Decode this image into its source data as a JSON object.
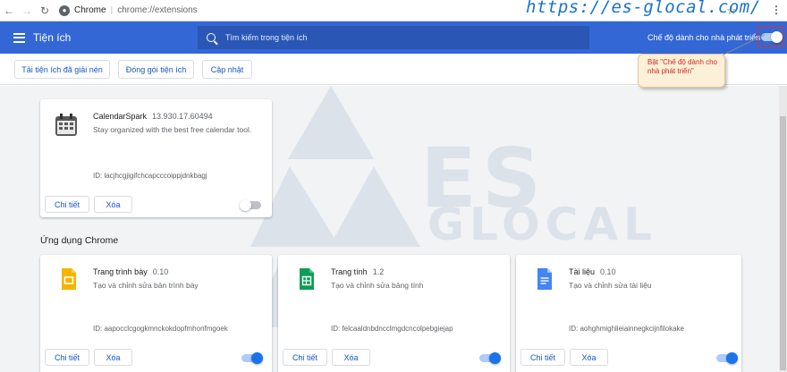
{
  "browser": {
    "site": "Chrome",
    "url": "chrome://extensions",
    "watermark": "https://es-glocal.com/"
  },
  "header": {
    "title": "Tiện ích",
    "search_placeholder": "Tìm kiếm trong tiện ích",
    "dev_mode_label": "Chế độ dành cho nhà phát triển",
    "dev_mode_on": true
  },
  "toolbar": {
    "load_unpacked": "Tải tiện ích đã giải nén",
    "pack_extension": "Đóng gói tiện ích",
    "update": "Cập nhật"
  },
  "callout": {
    "text": "Bật \"Chế độ dành cho nhà phát triển\""
  },
  "logo_watermark": {
    "line1": "ES",
    "line2": "GLOCAL"
  },
  "extensions": [
    {
      "name": "CalendarSpark",
      "version": "13.930.17.60494",
      "description": "Stay organized with the best free calendar tool.",
      "id": "ID: lacjhcgjigifchcapcccoippjdnkbagj",
      "details": "Chi tiết",
      "remove": "Xóa",
      "enabled": false
    }
  ],
  "apps_section": {
    "title": "Ứng dụng Chrome",
    "apps": [
      {
        "name": "Trang trình bày",
        "version": "0.10",
        "description": "Tạo và chỉnh sửa bản trình bày",
        "id": "ID: aapocclcgogkmnckokdopfmhonfmgoek",
        "details": "Chi tiết",
        "remove": "Xóa",
        "enabled": true
      },
      {
        "name": "Trang tính",
        "version": "1.2",
        "description": "Tạo và chỉnh sửa bảng tính",
        "id": "ID: felcaaldnbdncclmgdcncolpebgiejap",
        "details": "Chi tiết",
        "remove": "Xóa",
        "enabled": true
      },
      {
        "name": "Tài liệu",
        "version": "0.10",
        "description": "Tạo và chỉnh sửa tài liệu",
        "id": "ID: aohghmighlieiainnegkcijnfilokake",
        "details": "Chi tiết",
        "remove": "Xóa",
        "enabled": true
      }
    ]
  },
  "colors": {
    "header_blue": "#3367d6",
    "link_blue": "#1a57c0",
    "callout_red": "#d4261c",
    "slides_yellow": "#f4b400",
    "sheets_green": "#0f9d58",
    "docs_blue": "#4285f4"
  },
  "icons": {
    "back": "arrow-left-icon",
    "forward": "arrow-right-icon",
    "reload": "reload-icon",
    "site": "chrome-info-icon",
    "star": "bookmark-star-icon",
    "menu": "kebab-menu-icon",
    "hamburger": "hamburger-menu-icon",
    "search": "search-icon",
    "calendar": "calendar-icon",
    "slides": "slides-icon",
    "sheets": "sheets-icon",
    "docs": "docs-icon"
  }
}
